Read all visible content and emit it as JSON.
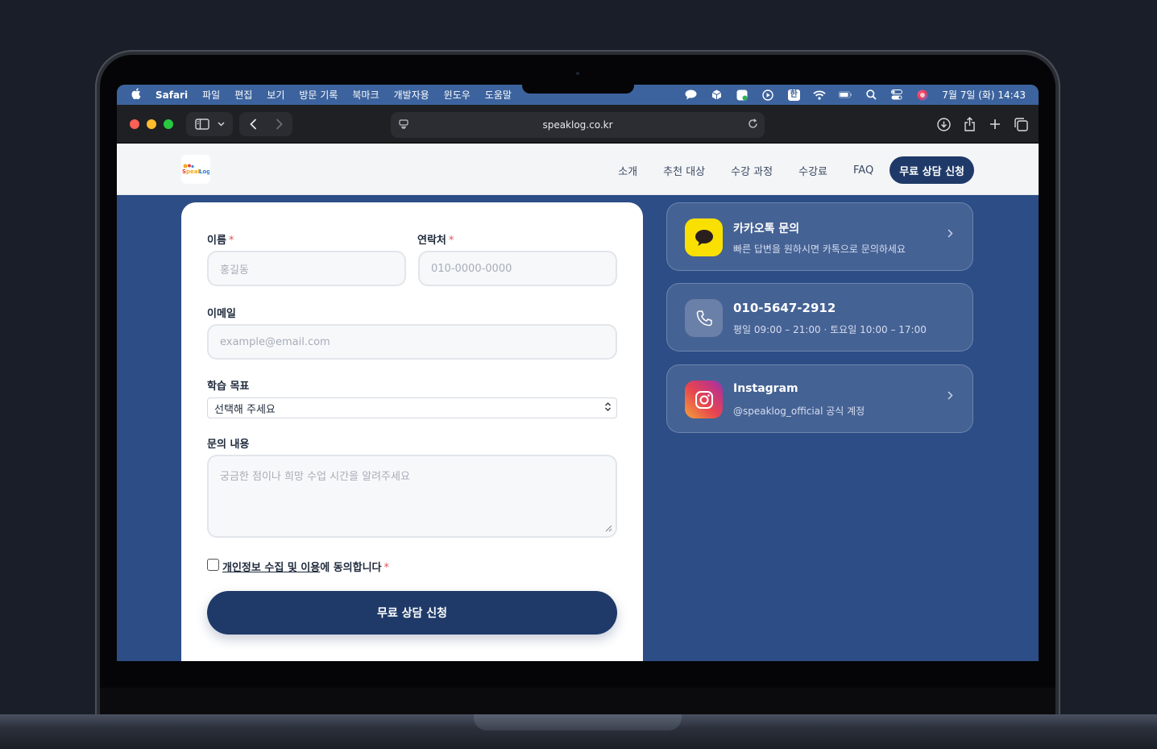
{
  "menubar": {
    "app": "Safari",
    "items": [
      "파일",
      "편집",
      "보기",
      "방문 기록",
      "북마크",
      "개발자용",
      "윈도우",
      "도움말"
    ],
    "clock": "7월 7일 (화) 14:43",
    "status_icons": [
      "chat-icon",
      "box-icon",
      "app-icon",
      "play-icon",
      "input-source-icon",
      "wifi-icon",
      "battery-icon",
      "spotlight-icon",
      "control-center-icon",
      "siri-icon"
    ],
    "input_source": "한"
  },
  "browser": {
    "url": "speaklog.co.kr"
  },
  "site": {
    "logo_text": "SpeakLog",
    "nav": [
      "소개",
      "추천 대상",
      "수강 과정",
      "수강료",
      "FAQ"
    ],
    "cta": "무료 상담 신청"
  },
  "form": {
    "name_label": "이름",
    "name_placeholder": "홍길동",
    "phone_label": "연락처",
    "phone_placeholder": "010-0000-0000",
    "email_label": "이메일",
    "email_placeholder": "example@email.com",
    "goal_label": "학습 목표",
    "goal_value": "선택해 주세요",
    "message_label": "문의 내용",
    "message_placeholder": "궁금한 점이나 희망 수업 시간을 알려주세요",
    "consent_link": "개인정보 수집 및 이용",
    "consent_rest": "에 동의합니다",
    "required_mark": "*",
    "submit": "무료 상담 신청"
  },
  "contacts": [
    {
      "title": "카카오톡 문의",
      "subtitle": "빠른 답변을 원하시면 카톡으로 문의하세요",
      "icon": "kakao-icon",
      "color": "#f9e000"
    },
    {
      "title": "010-5647-2912",
      "subtitle": "평일 09:00 – 21:00 · 토요일 10:00 – 17:00",
      "icon": "phone-icon",
      "color": "#6b80a8"
    },
    {
      "title": "Instagram",
      "subtitle": "@speaklog_official 공식 계정",
      "icon": "instagram-icon",
      "color": "#d63f6a"
    }
  ],
  "colors": {
    "primary": "#1f3a68",
    "background": "#2c4d86",
    "menubar": "#3c639e",
    "required": "#e05555"
  }
}
